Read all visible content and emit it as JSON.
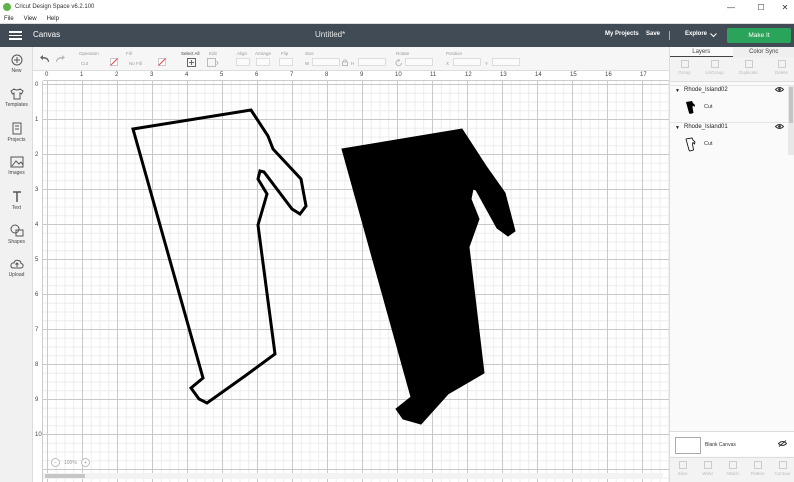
{
  "window": {
    "title": "Cricut Design Space  v6.2.100",
    "minimize": "—",
    "maximize": "☐",
    "close": "✕"
  },
  "menu": [
    "File",
    "View",
    "Help"
  ],
  "header": {
    "section": "Canvas",
    "doc_title": "Untitled*",
    "my_projects": "My Projects",
    "save": "Save",
    "explore": "Explore",
    "make_it": "Make It",
    "accent": "#2aa45a"
  },
  "sidebar": [
    {
      "label": "New",
      "icon": "plus-circle-icon"
    },
    {
      "label": "Templates",
      "icon": "shirt-icon"
    },
    {
      "label": "Projects",
      "icon": "projects-icon"
    },
    {
      "label": "Images",
      "icon": "image-icon"
    },
    {
      "label": "Text",
      "icon": "text-icon"
    },
    {
      "label": "Shapes",
      "icon": "shapes-icon"
    },
    {
      "label": "Upload",
      "icon": "cloud-upload-icon"
    }
  ],
  "toolbar": {
    "operation": "Operation",
    "operation_value": "Cut",
    "fill": "Fill",
    "fill_value": "No Fill",
    "select_all": "Select All",
    "edit": "Edit",
    "align": "Align",
    "arrange": "Arrange",
    "flip": "Flip",
    "size": "Size",
    "w": "W",
    "h": "H",
    "rotate": "Rotate",
    "position": "Position",
    "x": "X",
    "y": "Y"
  },
  "ruler": {
    "top": [
      "0",
      "1",
      "2",
      "3",
      "4",
      "5",
      "6",
      "7",
      "8",
      "9",
      "10",
      "11",
      "12",
      "13",
      "14",
      "15",
      "16",
      "17"
    ],
    "left": [
      "0",
      "1",
      "2",
      "3",
      "4",
      "5",
      "6",
      "7",
      "8",
      "9",
      "10"
    ]
  },
  "zoom": {
    "minus": "−",
    "value": "100%",
    "plus": "+"
  },
  "panel": {
    "tabs": [
      "Layers",
      "Color Sync"
    ],
    "actions": [
      "Group",
      "UnGroup",
      "Duplicate",
      "Delete"
    ],
    "groups": [
      {
        "name": "Rhode_Island02",
        "layer": "Cut"
      },
      {
        "name": "Rhode_Island01",
        "layer": "Cut"
      }
    ],
    "blank_canvas": "Blank Canvas",
    "bottom_actions": [
      "Slice",
      "Weld",
      "Attach",
      "Flatten",
      "Contour"
    ]
  }
}
